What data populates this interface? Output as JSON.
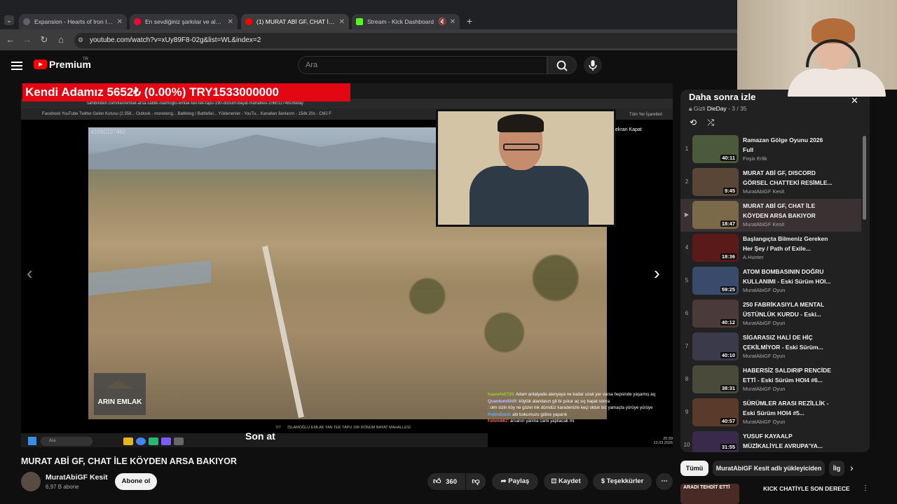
{
  "browser": {
    "tabs": [
      {
        "title": "Expansion - Hearts of Iron IV: N",
        "color": "#5f6368"
      },
      {
        "title": "En sevdiğiniz şarkılar ve albüml",
        "color": "#ff0033"
      },
      {
        "title": "(1) MURAT ABİ GF, CHAT İLE KÖ",
        "color": "#ff0000"
      },
      {
        "title": "Stream - Kick Dashboard",
        "color": "#53fc18"
      }
    ],
    "url": "youtube.com/watch?v=xUy89F8-02g&list=WL&index=2"
  },
  "youtube": {
    "logo_text": "Premium",
    "region": "TR",
    "search_placeholder": "Ara"
  },
  "player": {
    "ticker": "Kendi Adamız    5652₺ (0.00%) TRY1533000000",
    "embed_url": "sahibinden.com/ilan/emlak-arsa-satilik-islamoglu-emlak-tan-tek-tapu-190-donum-bayat-mahallesi-1060127482/detay",
    "bookmarks": "Facebook   YouTube   Twitter   Gelen Kutusu (2.358...   Outlook - moneteng...   Battlelog / Battlefiel...   Yüklenenler - YouTu...   Kanalları   İlanlarım - 15dk 20s -   CMJ F",
    "bookmarks_right": "Tüm Yer İşaretleri",
    "listing_id": "#1060127482",
    "embed_right": "ekran   Kapat",
    "agency_logo": "ARIN EMLAK",
    "caption_counter": "7/7",
    "caption_text": "İSLAMOĞLU EMLAK TAN TEK TAPU 190 DÖNÜM BAYAT MAHALLESİ",
    "subtitle": "Son at",
    "taskbar_search": "Ara",
    "tray_time": "20:39",
    "tray_date": "13.03.2026",
    "chat": [
      {
        "user": "kaanefe0735",
        "text": ": Adam antalyada alanyaya ne kadar uzak yer varsa hepsinde yaşamış aq",
        "color": "#9acd32"
      },
      {
        "user": "QuantumShift",
        "text": ": köylük alandasın git bi çukur aç sıç kapat sonra",
        "color": "#c0c0ff"
      },
      {
        "user": "",
        "text": ": olm sizin köy ne güzel mk dümdüz karadenizle keçi olduk biz yamaçta yürüye yürüye",
        "color": "#ff66cc"
      },
      {
        "user": "PekinDuck",
        "text": ": abi bokumuzu gübre yaparık",
        "color": "#66b3ff"
      },
      {
        "user": "Fehmi667",
        "text": ": arsanın yanina cami yapilacak mi",
        "color": "#ff6666"
      }
    ]
  },
  "video": {
    "title": "MURAT ABİ GF, CHAT İLE KÖYDEN ARSA BAKIYOR",
    "channel": "MuratAbiGF Kesit",
    "subs": "6,97 B abone",
    "subscribe": "Abone ol",
    "likes": "360",
    "share": "Paylaş",
    "save": "Kaydet",
    "thanks": "Teşekkürler"
  },
  "playlist": {
    "title": "Daha sonra izle",
    "privacy": "Gizli",
    "owner": "DieDay",
    "position": "3 / 35",
    "items": [
      {
        "num": "1",
        "title": "Ramazan Gölge Oyunu 2026 Full",
        "channel": "Foşix Erlik",
        "dur": "40:11",
        "thumb": "#4a5a3a"
      },
      {
        "num": "2",
        "title": "MURAT ABİ GF, DISCORD GÖRSEL CHATTEKİ RESİMLE...",
        "channel": "MuratAbiGF Kesit",
        "dur": "9:45",
        "thumb": "#5a4636"
      },
      {
        "num": "▶",
        "title": "MURAT ABİ GF, CHAT İLE KÖYDEN ARSA BAKIYOR",
        "channel": "MuratAbiGF Kesit",
        "dur": "18:47",
        "thumb": "#7a6a4a"
      },
      {
        "num": "4",
        "title": "Başlangıçta Bilmeniz Gereken Her Şey / Path of Exile...",
        "channel": "A.Hunter",
        "dur": "18:36",
        "thumb": "#5a1a1a"
      },
      {
        "num": "5",
        "title": "ATOM BOMBASININ DOĞRU KULLANIMI - Eski Sürüm HOI...",
        "channel": "MuratAbiGF Oyun",
        "dur": "59:25",
        "thumb": "#3a4a6a"
      },
      {
        "num": "6",
        "title": "250 FABRİKASIYLA MENTAL ÜSTÜNLÜK KURDU - Eski...",
        "channel": "MuratAbiGF Oyun",
        "dur": "40:12",
        "thumb": "#4a3a3a"
      },
      {
        "num": "7",
        "title": "SİGARASIZ HALİ DE HİÇ ÇEKİLMİYOR - Eski Sürüm...",
        "channel": "MuratAbiGF Oyun",
        "dur": "40:10",
        "thumb": "#3a3a4a"
      },
      {
        "num": "8",
        "title": "HABERSİZ SALDIRIP RENCİDE ETTİ - Eski Sürüm HOI4 #6...",
        "channel": "MuratAbiGF Oyun",
        "dur": "38:31",
        "thumb": "#4a4a3a"
      },
      {
        "num": "9",
        "title": "SÜRÜMLER ARASI REZİLLİK - Eski Sürüm HOI4 #5...",
        "channel": "MuratAbiGF Oyun",
        "dur": "40:57",
        "thumb": "#5a3a2a"
      },
      {
        "num": "10",
        "title": "YUSUF KAYAALP MÜZİKALİYLE AVRUPA'YA...",
        "channel": "",
        "dur": "31:55",
        "thumb": "#3a2a4a"
      }
    ]
  },
  "chips": {
    "all": "Tümü",
    "uploads": "MuratAbiGF Kesit adlı yükleyiciden",
    "related": "İlg"
  },
  "recommendation": {
    "thumb_text": "ARADI TEHDİT ETTİ",
    "title": "KICK CHATİYLE SON DERECE"
  }
}
